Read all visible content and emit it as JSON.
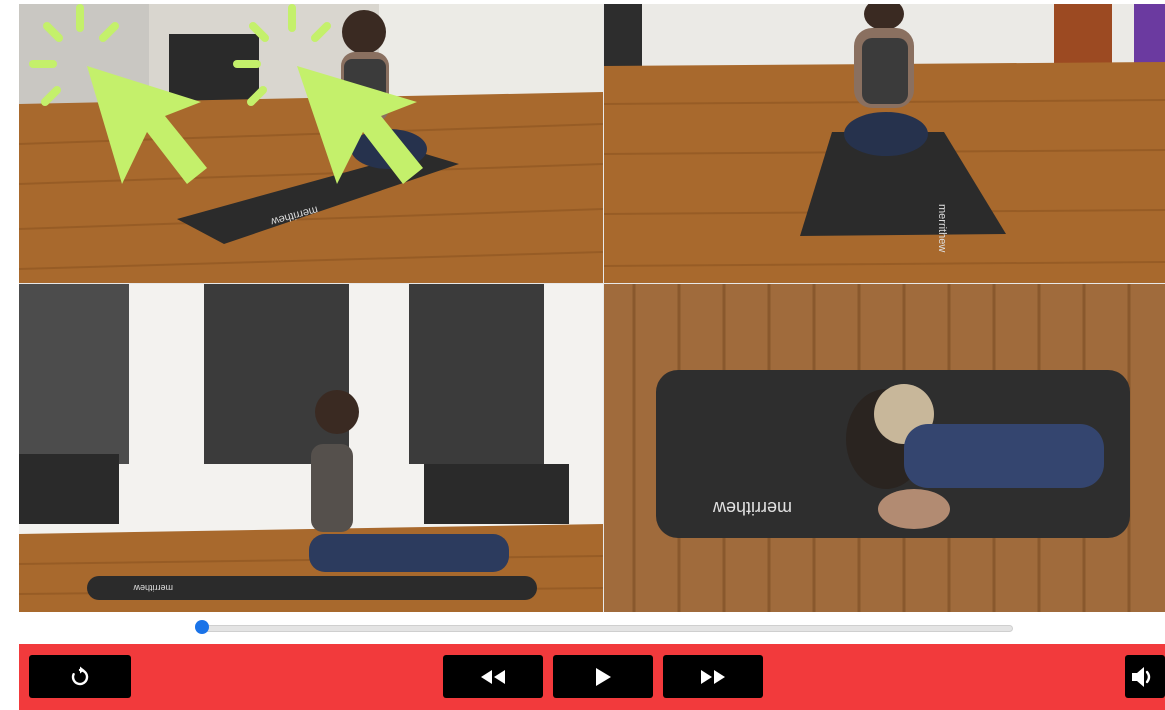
{
  "player": {
    "panes": [
      {
        "name": "front-left-view",
        "mat_logo": "merrithew"
      },
      {
        "name": "rear-view",
        "mat_logo": "merrithew"
      },
      {
        "name": "side-view",
        "mat_logo": "merrithew"
      },
      {
        "name": "top-down-view",
        "mat_logo": "merrithew"
      }
    ],
    "overlay": {
      "cursor_icon_count": 2,
      "cursor_color": "#c4f06b"
    },
    "progress": {
      "value": 0.0
    },
    "controls": {
      "background": "#f23a3c",
      "buttons": [
        "restart-icon",
        "rewind-icon",
        "play-icon",
        "fast-forward-icon",
        "volume-icon"
      ]
    }
  }
}
